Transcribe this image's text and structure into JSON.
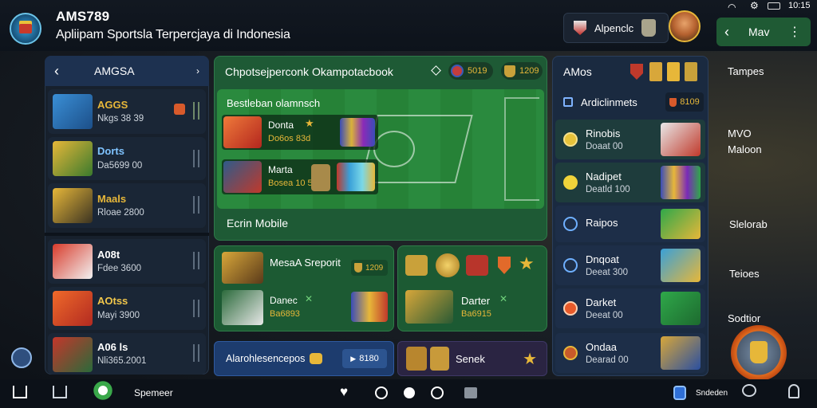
{
  "header": {
    "title": "AMS789",
    "subtitle": "Apliipam Sportsla Terpercjaya di Indonesia",
    "account_label": "Alpenclc"
  },
  "status_bar": {
    "time": "10:15"
  },
  "right_header": {
    "label": "Mav"
  },
  "left_panel": {
    "title": "AMGSA",
    "items": [
      {
        "name": "AGGS",
        "detail": "Nkgs 38 39"
      },
      {
        "name": "Dorts",
        "detail": "Da5699 00"
      },
      {
        "name": "Maals",
        "detail": "Rloae 2800"
      },
      {
        "name": "A08t",
        "detail": "Fdee 3600"
      },
      {
        "name": "AOtss",
        "detail": "Mayi 3900"
      },
      {
        "name": "A06 ls",
        "detail": "Nli365.2001"
      }
    ]
  },
  "center": {
    "top_title": "Chpotsejperconk Okampotacbook",
    "top_badges": [
      "5019",
      "1209"
    ],
    "featured_title": "Bestleban olamnsch",
    "featured_matches": [
      {
        "name": "Donta",
        "detail": "Do6os 83d"
      },
      {
        "name": "Marta",
        "detail": "Bosea 10 5"
      }
    ],
    "bottom_label": "Ecrin Mobile",
    "cards": [
      {
        "title": "MesaA Sreporit",
        "badge": "1209"
      },
      {
        "title": "Danec",
        "detail": "Ba6893"
      },
      {
        "title": "Darter",
        "detail": "Ba6915"
      }
    ],
    "promo_left": {
      "label": "Alarohlesencepos",
      "badge": "8180"
    },
    "promo_right": {
      "label": "Senek"
    }
  },
  "right_panel": {
    "title": "AMos",
    "subtitle": "Ardiclinmets",
    "subtitle_badge": "8109",
    "items": [
      {
        "name": "Rinobis",
        "detail": "Doaat 00"
      },
      {
        "name": "Nadipet",
        "detail": "Deatld 100"
      },
      {
        "name": "Raipos",
        "detail": ""
      },
      {
        "name": "Dnqoat",
        "detail": "Deeat 300"
      },
      {
        "name": "Darket",
        "detail": "Deeat 00"
      },
      {
        "name": "Ondaa",
        "detail": "Dearad 00"
      }
    ]
  },
  "side_menu": {
    "items": [
      "Tampes",
      "MVO",
      "Maloon",
      "Slelorab",
      "Teioes",
      "Sodtior"
    ]
  },
  "bottom_nav": {
    "label": "Spemeer",
    "right_label": "Sndeden"
  },
  "colors": {
    "accent_green": "#1f6f3a",
    "accent_gold": "#e7b739",
    "panel_blue": "#1c2c44",
    "fab_orange": "#e06a1e"
  }
}
